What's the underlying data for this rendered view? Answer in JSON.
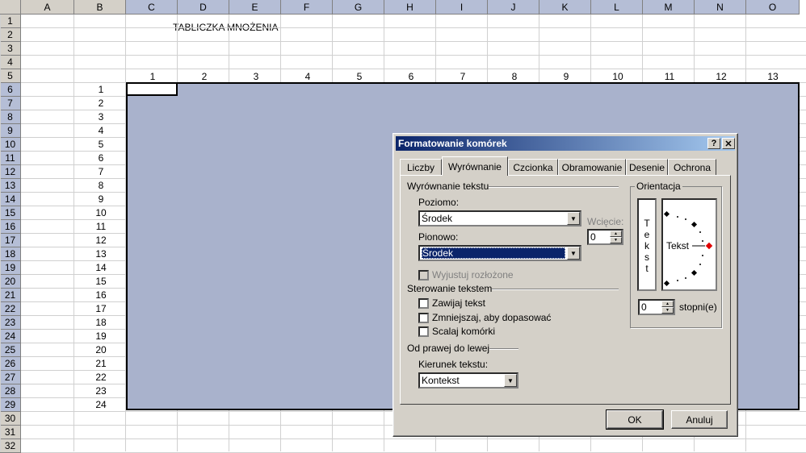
{
  "spreadsheet": {
    "columns": [
      "A",
      "B",
      "C",
      "D",
      "E",
      "F",
      "G",
      "H",
      "I",
      "J",
      "K",
      "L",
      "M",
      "N",
      "O"
    ],
    "rows": [
      "1",
      "2",
      "3",
      "4",
      "5",
      "6",
      "7",
      "8",
      "9",
      "10",
      "11",
      "12",
      "13",
      "14",
      "15",
      "16",
      "17",
      "18",
      "19",
      "20",
      "21",
      "22",
      "23",
      "24",
      "25",
      "26",
      "27",
      "28",
      "29",
      "30",
      "31",
      "32"
    ],
    "title": "TABLICZKA MNOŻENIA",
    "header_numbers": [
      "1",
      "2",
      "3",
      "4",
      "5",
      "6",
      "7",
      "8",
      "9",
      "10",
      "11",
      "12",
      "13"
    ],
    "row_numbers": [
      "1",
      "2",
      "3",
      "4",
      "5",
      "6",
      "7",
      "8",
      "9",
      "10",
      "11",
      "12",
      "13",
      "14",
      "15",
      "16",
      "17",
      "18",
      "19",
      "20",
      "21",
      "22",
      "23",
      "24"
    ],
    "selection_color": "#a9b2cc"
  },
  "dialog": {
    "title": "Formatowanie komórek",
    "help_label": "?",
    "close_label": "✕",
    "tabs": [
      "Liczby",
      "Wyrównanie",
      "Czcionka",
      "Obramowanie",
      "Desenie",
      "Ochrona"
    ],
    "active_tab": "Wyrównanie",
    "text_alignment": {
      "group_label": "Wyrównanie tekstu",
      "horizontal_label": "Poziomo:",
      "horizontal_value": "Środek",
      "vertical_label": "Pionowo:",
      "vertical_value": "Środek",
      "indent_label": "Wcięcie:",
      "indent_value": "0",
      "justify_distributed_label": "Wyjustuj rozłożone"
    },
    "text_control": {
      "group_label": "Sterowanie tekstem",
      "wrap_label": "Zawijaj tekst",
      "shrink_label": "Zmniejszaj, aby dopasować",
      "merge_label": "Scalaj komórki"
    },
    "rtl": {
      "group_label": "Od prawej do lewej",
      "direction_label": "Kierunek tekstu:",
      "direction_value": "Kontekst"
    },
    "orientation": {
      "group_label": "Orientacja",
      "vertical_text": [
        "T",
        "e",
        "k",
        "s",
        "t"
      ],
      "text_label": "Tekst",
      "degrees_value": "0",
      "degrees_label": "stopni(e)"
    },
    "ok_label": "OK",
    "cancel_label": "Anuluj"
  }
}
